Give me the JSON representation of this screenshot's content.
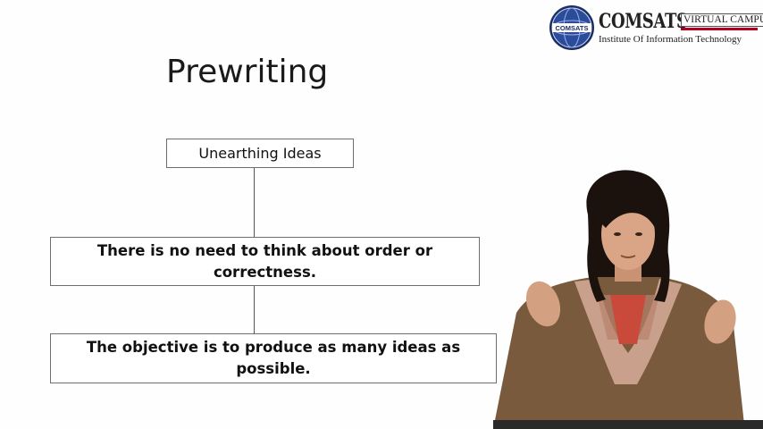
{
  "logo": {
    "brand": "COMSATS",
    "seal_text": "COMSATS",
    "badge": "VIRTUAL CAMPUS",
    "subtitle": "Institute Of Information Technology",
    "colors": {
      "seal": "#1f3a78",
      "rule": "#b00020"
    }
  },
  "slide": {
    "title": "Prewriting",
    "boxes": [
      {
        "text": "Unearthing Ideas"
      },
      {
        "text": "There is no need to think about order or correctness."
      },
      {
        "text": "The objective is to produce as many ideas as possible."
      }
    ]
  },
  "presenter": {
    "icon": "presenter-figure"
  }
}
